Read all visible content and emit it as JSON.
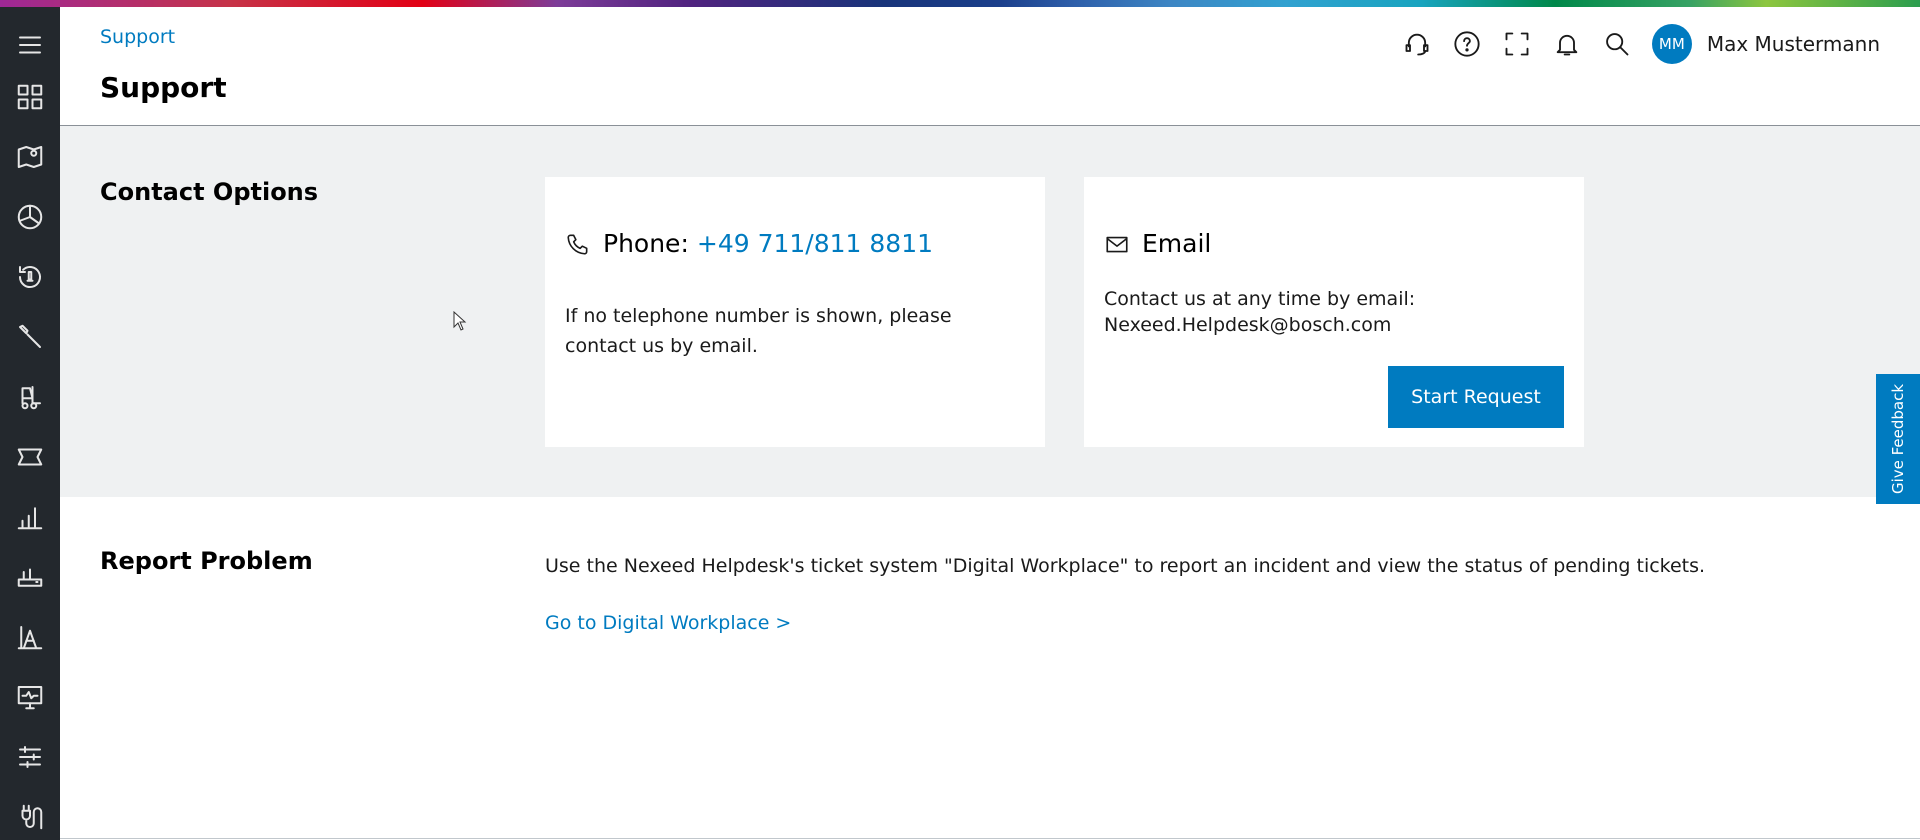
{
  "header": {
    "breadcrumb": "Support",
    "title": "Support",
    "icons": [
      "headset-icon",
      "help-icon",
      "fullscreen-icon",
      "bell-icon",
      "search-icon"
    ],
    "user": {
      "initials": "MM",
      "name": "Max Mustermann"
    }
  },
  "sidebar": {
    "items": [
      "menu-icon",
      "dashboard-icon",
      "map-icon",
      "pie-chart-icon",
      "alarm-history-icon",
      "wrench-icon",
      "forklift-icon",
      "ticket-icon",
      "bar-chart-icon",
      "router-icon",
      "triangle-chart-icon",
      "monitor-icon",
      "sliders-icon",
      "cable-icon"
    ]
  },
  "contact": {
    "title": "Contact Options",
    "phone": {
      "label": "Phone:",
      "number": "+49 711/811 8811",
      "note": "If no telephone number is shown, please contact us by email."
    },
    "email": {
      "label": "Email",
      "line1": "Contact us at any time by email:",
      "address": "Nexeed.Helpdesk@bosch.com",
      "button": "Start Request"
    }
  },
  "report": {
    "title": "Report Problem",
    "text": "Use the Nexeed Helpdesk's ticket system \"Digital Workplace\" to report an incident and view the status of pending tickets.",
    "link": "Go to Digital Workplace >"
  },
  "feedback": {
    "label": "Give Feedback"
  },
  "colors": {
    "accent": "#007bc0",
    "sidebar": "#23282d",
    "section_bg": "#eff1f2"
  }
}
